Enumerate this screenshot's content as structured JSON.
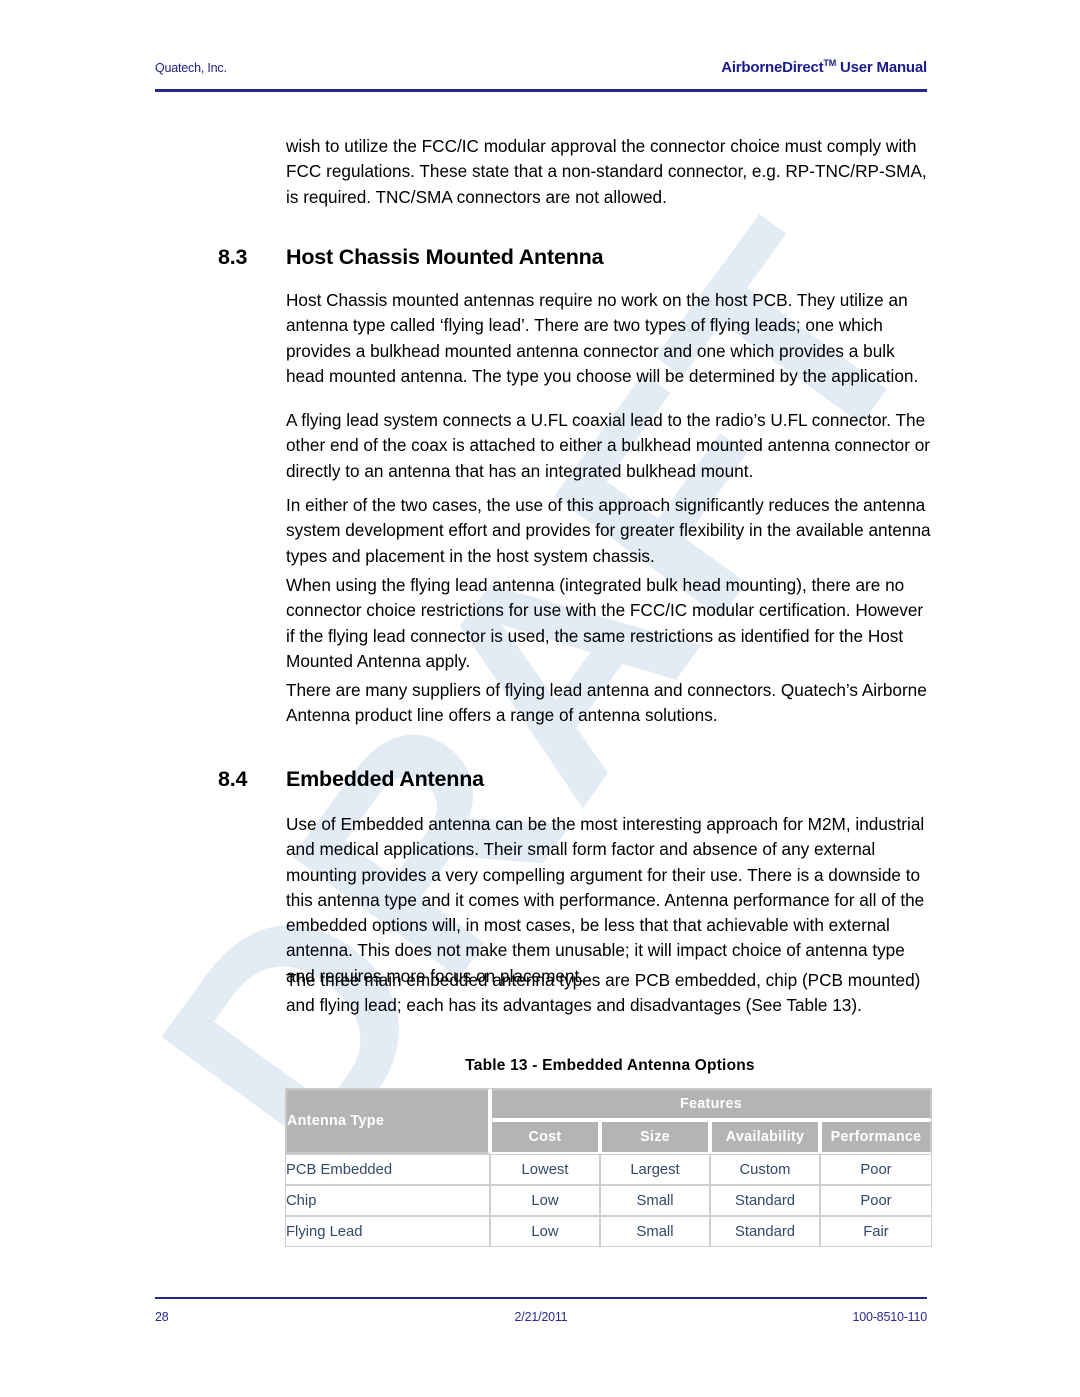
{
  "header": {
    "left": "Quatech, Inc.",
    "right_main": "AirborneDirect",
    "right_tm": "TM",
    "right_suffix": " User Manual"
  },
  "watermark": {
    "text": "DRAFT",
    "color": "#e3ebf5"
  },
  "body": {
    "intro_paragraph": "wish to utilize the FCC/IC modular approval the connector choice must comply with FCC regulations. These state that a non-standard connector, e.g. RP-TNC/RP-SMA, is required.   TNC/SMA connectors are not allowed.",
    "sections": [
      {
        "number": "8.3",
        "title": "Host Chassis Mounted Antenna",
        "paragraphs": [
          "Host Chassis mounted antennas require no work on the host PCB. They utilize an antenna type called ‘flying lead’. There are two types of flying leads; one which provides a bulkhead mounted antenna connector and one which provides a bulk head mounted antenna. The type you choose will be determined by the application.",
          "A flying lead system connects a U.FL coaxial lead to the radio’s U.FL connector. The other end of the coax is attached to either a bulkhead mounted antenna connector or directly to an antenna that has an integrated bulkhead mount.",
          "In either of the two cases, the use of this approach significantly reduces the antenna system development effort and provides for greater flexibility in the available antenna types and placement in the host system chassis.",
          "When using the flying lead antenna (integrated bulk head mounting), there are no connector choice restrictions for use with the FCC/IC modular certification. However if the flying lead connector is used, the same restrictions as identified for the Host Mounted Antenna apply.",
          "There are many suppliers of flying lead antenna and connectors.  Quatech’s Airborne Antenna product line offers a range of antenna solutions."
        ]
      },
      {
        "number": "8.4",
        "title": "Embedded Antenna",
        "paragraphs": [
          "Use of Embedded antenna can be the most interesting approach for M2M, industrial and medical applications. Their small form factor and absence of any external mounting provides a very compelling argument for their use. There is a downside to this antenna type and it comes with performance. Antenna performance for all of the embedded options will, in most cases, be less that that achievable with external antenna. This does not make them unusable; it will impact choice of antenna type and requires more focus on placement.",
          "The three main embedded antenna types are PCB embedded, chip (PCB mounted) and flying lead; each has its advantages and disadvantages (See Table 13)."
        ]
      }
    ]
  },
  "table": {
    "caption": "Table 13 - Embedded Antenna Options",
    "header_type": "Antenna Type",
    "header_group": "Features",
    "subheaders": [
      "Cost",
      "Size",
      "Availability",
      "Performance"
    ],
    "rows": [
      {
        "type": "PCB Embedded",
        "cost": "Lowest",
        "size": "Largest",
        "availability": "Custom",
        "performance": "Poor"
      },
      {
        "type": "Chip",
        "cost": "Low",
        "size": "Small",
        "availability": "Standard",
        "performance": "Poor"
      },
      {
        "type": "Flying Lead",
        "cost": "Low",
        "size": "Small",
        "availability": "Standard",
        "performance": "Fair"
      }
    ],
    "header_bg": "#b4b4b4",
    "cell_text_color": "#33486b"
  },
  "footer": {
    "page_number": "28",
    "date": "2/21/2011",
    "doc_number": "100-8510-110"
  }
}
